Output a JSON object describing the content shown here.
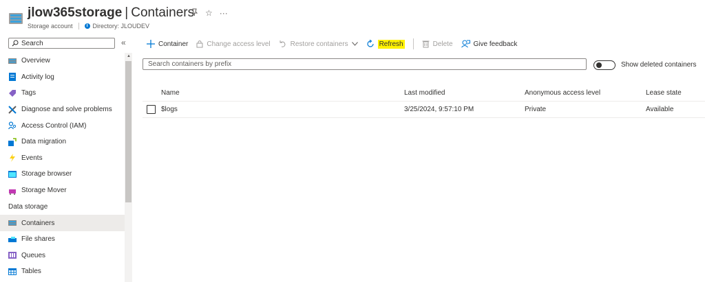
{
  "header": {
    "resource_name": "jlow365storage",
    "separator": "|",
    "page": "Containers",
    "resource_type": "Storage account",
    "directory": "Directory: JLOUDEV",
    "pin_glyph": "✪",
    "star_glyph": "☆",
    "more_glyph": "···"
  },
  "sidebar": {
    "search_placeholder": "Search",
    "collapse_glyph": "«",
    "items": [
      {
        "label": "Overview",
        "icon": "overview-icon"
      },
      {
        "label": "Activity log",
        "icon": "activity-log-icon"
      },
      {
        "label": "Tags",
        "icon": "tag-icon"
      },
      {
        "label": "Diagnose and solve problems",
        "icon": "diagnose-icon"
      },
      {
        "label": "Access Control (IAM)",
        "icon": "iam-icon"
      },
      {
        "label": "Data migration",
        "icon": "data-migration-icon"
      },
      {
        "label": "Events",
        "icon": "events-icon"
      },
      {
        "label": "Storage browser",
        "icon": "storage-browser-icon"
      },
      {
        "label": "Storage Mover",
        "icon": "storage-mover-icon"
      }
    ],
    "section_label": "Data storage",
    "data_items": [
      {
        "label": "Containers",
        "icon": "containers-icon",
        "active": true
      },
      {
        "label": "File shares",
        "icon": "file-shares-icon"
      },
      {
        "label": "Queues",
        "icon": "queues-icon"
      },
      {
        "label": "Tables",
        "icon": "tables-icon"
      }
    ]
  },
  "toolbar": {
    "container": "Container",
    "change_access": "Change access level",
    "restore": "Restore containers",
    "refresh": "Refresh",
    "delete": "Delete",
    "feedback": "Give feedback"
  },
  "filter": {
    "placeholder": "Search containers by prefix",
    "toggle_label": "Show deleted containers"
  },
  "table": {
    "columns": [
      "Name",
      "Last modified",
      "Anonymous access level",
      "Lease state"
    ],
    "rows": [
      {
        "name": "$logs",
        "last_modified": "3/25/2024, 9:57:10 PM",
        "access": "Private",
        "lease": "Available"
      }
    ]
  },
  "colors": {
    "accent": "#0078d4",
    "highlight": "#fff200",
    "active_row": "#edebe9"
  }
}
